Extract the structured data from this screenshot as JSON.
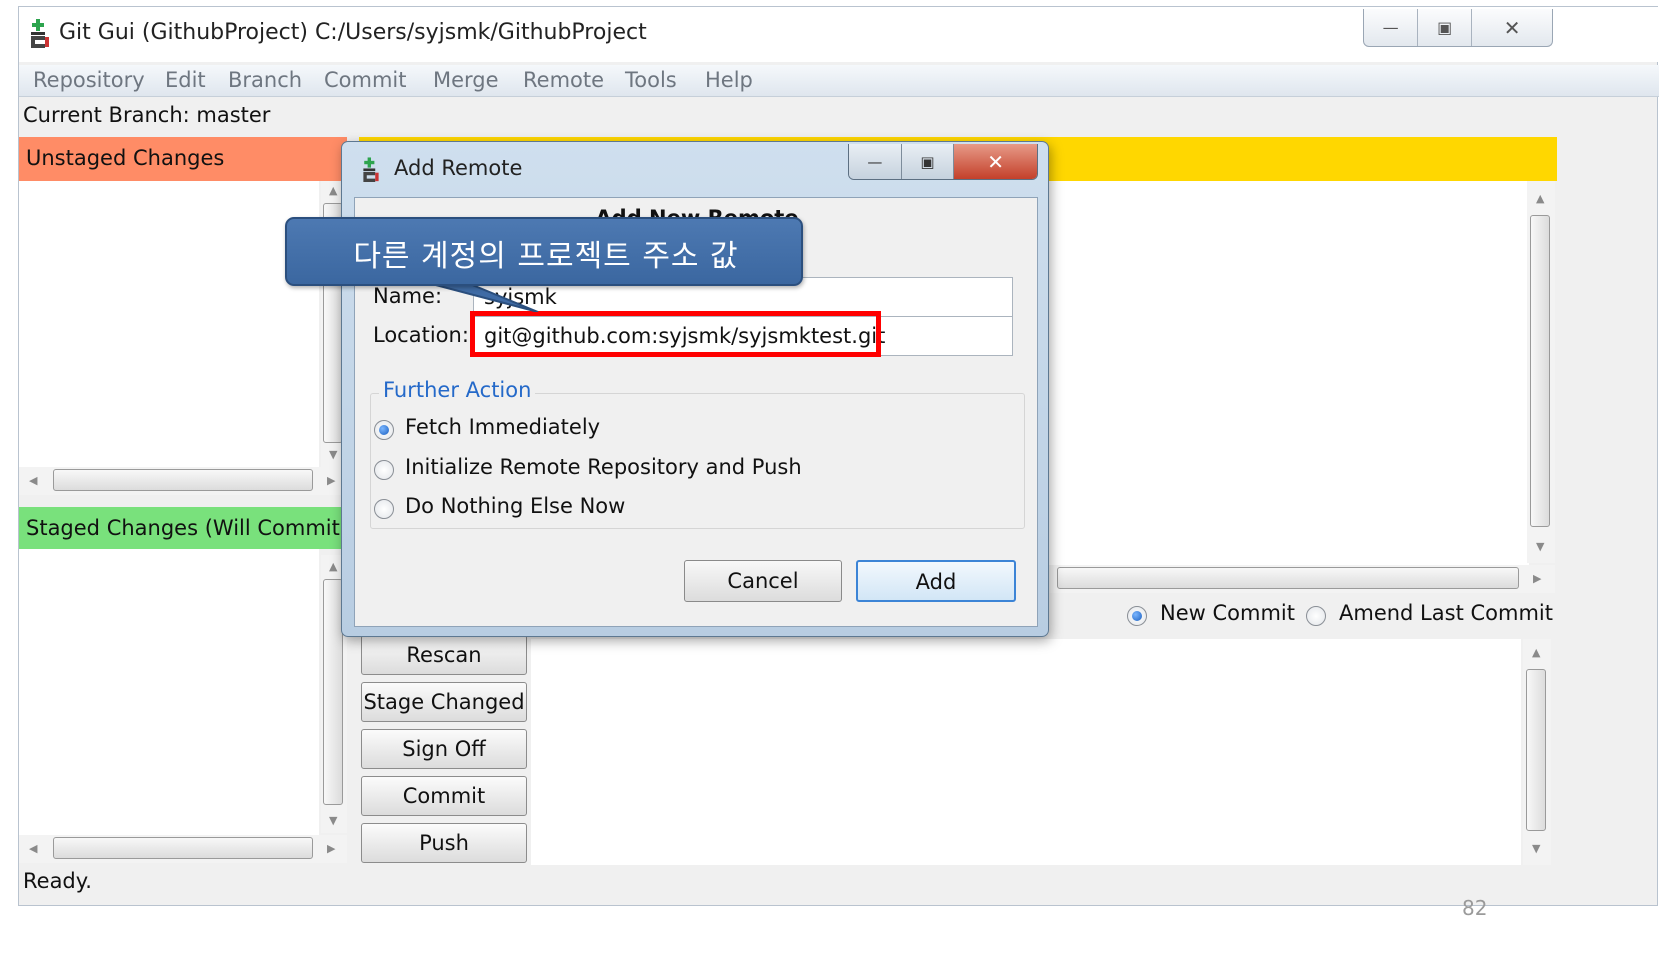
{
  "window": {
    "title": "Git Gui (GithubProject) C:/Users/syjsmk/GithubProject",
    "controls": {
      "minimize": "—",
      "maximize": "▣",
      "close": "✕"
    }
  },
  "menu": [
    "Repository",
    "Edit",
    "Branch",
    "Commit",
    "Merge",
    "Remote",
    "Tools",
    "Help"
  ],
  "branch": {
    "text": "Current Branch: master"
  },
  "panes": {
    "unstaged": "Unstaged Changes",
    "staged": "Staged Changes (Will Commit)"
  },
  "commit_mode": {
    "options": [
      {
        "label": "New Commit",
        "selected": true
      },
      {
        "label": "Amend Last Commit",
        "selected": false
      }
    ]
  },
  "side_buttons": {
    "rescan": "Rescan",
    "stage_changed": "Stage Changed",
    "sign_off": "Sign Off",
    "commit": "Commit",
    "push": "Push"
  },
  "status": "Ready.",
  "dialog": {
    "title": "Add Remote",
    "heading": "Add New Remote",
    "name_label": "Name:",
    "name_value": "syjsmk",
    "location_label": "Location:",
    "location_value": "git@github.com:syjsmk/syjsmktest.git",
    "further_action": {
      "legend": "Further Action",
      "options": [
        {
          "label": "Fetch Immediately",
          "selected": true
        },
        {
          "label": "Initialize Remote Repository and Push",
          "selected": false
        },
        {
          "label": "Do Nothing Else Now",
          "selected": false
        }
      ]
    },
    "cancel": "Cancel",
    "add": "Add"
  },
  "annotation": {
    "callout_text": "다른 계정의 프로젝트 주소 값",
    "highlight_color": "#ff0000",
    "callout_color": "#3f6ba5"
  },
  "colors": {
    "unstaged": "#ff8c66",
    "staged": "#79e17c",
    "diff_header": "#ffd700",
    "further_action": "#2469c9"
  },
  "page_fragment": "82"
}
